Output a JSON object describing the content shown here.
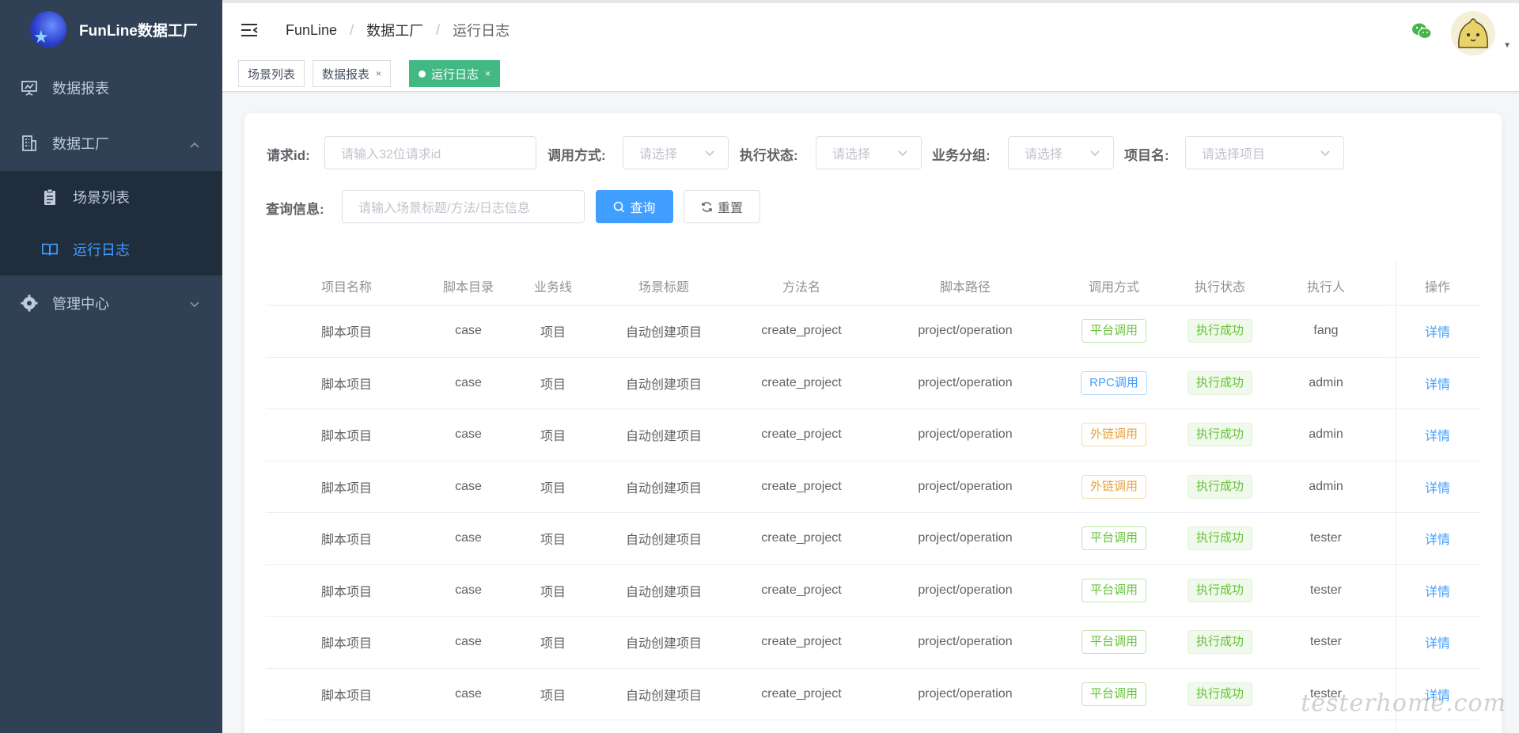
{
  "app": {
    "title": "FunLine数据工厂"
  },
  "sidebar": {
    "items": [
      {
        "label": "数据报表",
        "icon": "presentation-icon"
      },
      {
        "label": "数据工厂",
        "icon": "building-icon",
        "expanded": true,
        "children": [
          {
            "label": "场景列表",
            "icon": "clipboard-icon"
          },
          {
            "label": "运行日志",
            "icon": "book-icon",
            "active": true
          }
        ]
      },
      {
        "label": "管理中心",
        "icon": "gear-icon"
      }
    ]
  },
  "header": {
    "breadcrumb": [
      "FunLine",
      "数据工厂",
      "运行日志"
    ]
  },
  "tags": [
    {
      "label": "场景列表",
      "closable": false
    },
    {
      "label": "数据报表",
      "closable": true,
      "close": "×"
    },
    {
      "label": "运行日志",
      "closable": true,
      "close": "×",
      "active": true
    }
  ],
  "filters": {
    "request_id": {
      "label": "请求id:",
      "placeholder": "请输入32位请求id"
    },
    "call_type": {
      "label": "调用方式:",
      "placeholder": "请选择"
    },
    "exec_status": {
      "label": "执行状态:",
      "placeholder": "请选择"
    },
    "biz_group": {
      "label": "业务分组:",
      "placeholder": "请选择"
    },
    "project": {
      "label": "项目名:",
      "placeholder": "请选择项目"
    },
    "query_info": {
      "label": "查询信息:",
      "placeholder": "请输入场景标题/方法/日志信息"
    },
    "search_label": "查询",
    "reset_label": "重置"
  },
  "table": {
    "columns": [
      "项目名称",
      "脚本目录",
      "业务线",
      "场景标题",
      "方法名",
      "脚本路径",
      "调用方式",
      "执行状态",
      "执行人",
      "操作"
    ],
    "rows": [
      {
        "project": "脚本项目",
        "dir": "case",
        "biz": "项目",
        "title": "自动创建项目",
        "method": "create_project",
        "path": "project/operation",
        "call": "平台调用",
        "call_style": "success",
        "status": "执行成功",
        "user": "fang",
        "action": "详情"
      },
      {
        "project": "脚本项目",
        "dir": "case",
        "biz": "项目",
        "title": "自动创建项目",
        "method": "create_project",
        "path": "project/operation",
        "call": "RPC调用",
        "call_style": "primary",
        "status": "执行成功",
        "user": "admin",
        "action": "详情"
      },
      {
        "project": "脚本项目",
        "dir": "case",
        "biz": "项目",
        "title": "自动创建项目",
        "method": "create_project",
        "path": "project/operation",
        "call": "外链调用",
        "call_style": "warning",
        "status": "执行成功",
        "user": "admin",
        "action": "详情"
      },
      {
        "project": "脚本项目",
        "dir": "case",
        "biz": "项目",
        "title": "自动创建项目",
        "method": "create_project",
        "path": "project/operation",
        "call": "外链调用",
        "call_style": "warning",
        "status": "执行成功",
        "user": "admin",
        "action": "详情"
      },
      {
        "project": "脚本项目",
        "dir": "case",
        "biz": "项目",
        "title": "自动创建项目",
        "method": "create_project",
        "path": "project/operation",
        "call": "平台调用",
        "call_style": "success",
        "status": "执行成功",
        "user": "tester",
        "action": "详情"
      },
      {
        "project": "脚本项目",
        "dir": "case",
        "biz": "项目",
        "title": "自动创建项目",
        "method": "create_project",
        "path": "project/operation",
        "call": "平台调用",
        "call_style": "success",
        "status": "执行成功",
        "user": "tester",
        "action": "详情"
      },
      {
        "project": "脚本项目",
        "dir": "case",
        "biz": "项目",
        "title": "自动创建项目",
        "method": "create_project",
        "path": "project/operation",
        "call": "平台调用",
        "call_style": "success",
        "status": "执行成功",
        "user": "tester",
        "action": "详情"
      },
      {
        "project": "脚本项目",
        "dir": "case",
        "biz": "项目",
        "title": "自动创建项目",
        "method": "create_project",
        "path": "project/operation",
        "call": "平台调用",
        "call_style": "success",
        "status": "执行成功",
        "user": "tester",
        "action": "详情"
      }
    ]
  },
  "watermark": "testerhome.com",
  "colors": {
    "sidebar_bg": "#304156",
    "submenu_bg": "#1f2d3d",
    "active": "#409eff",
    "tag_active": "#42b983"
  }
}
